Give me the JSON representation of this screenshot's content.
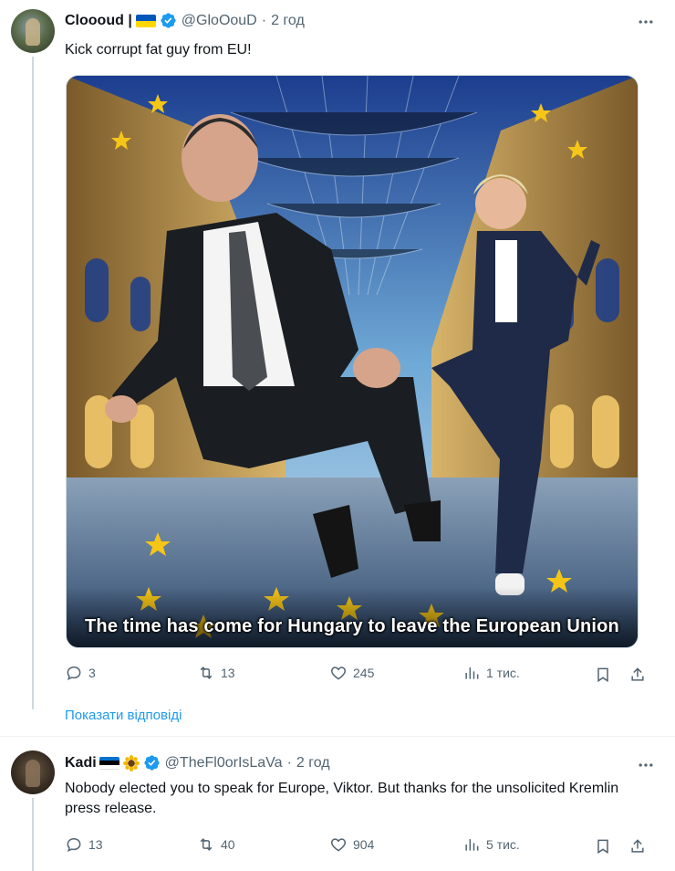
{
  "tweet1": {
    "name": "Cloooud |",
    "handle": "@GloOouD",
    "separator": "·",
    "time": "2 год",
    "text": "Kick corrupt fat guy from EU!",
    "image_caption": "The time has come for Hungary to leave the European Union",
    "replies": "3",
    "reposts": "13",
    "likes": "245",
    "views": "1 тис."
  },
  "show_replies": "Показати відповіді",
  "tweet2": {
    "name": "Kadi",
    "handle": "@TheFl0orIsLaVa",
    "separator": "·",
    "time": "2 год",
    "text": "Nobody elected you to speak for Europe, Viktor. But thanks for the unsolicited Kremlin press release.",
    "replies": "13",
    "reposts": "40",
    "likes": "904",
    "views": "5 тис."
  },
  "colors": {
    "accent": "#1d9bf0",
    "secondary_text": "#536471",
    "eu_blue": "#1f3f8f",
    "eu_star": "#f5c518"
  },
  "icons": [
    "reply-icon",
    "repost-icon",
    "like-icon",
    "views-icon",
    "bookmark-icon",
    "share-icon",
    "more-icon",
    "verified-badge-icon",
    "ukraine-flag-icon",
    "estonia-flag-icon",
    "sunflower-icon"
  ]
}
